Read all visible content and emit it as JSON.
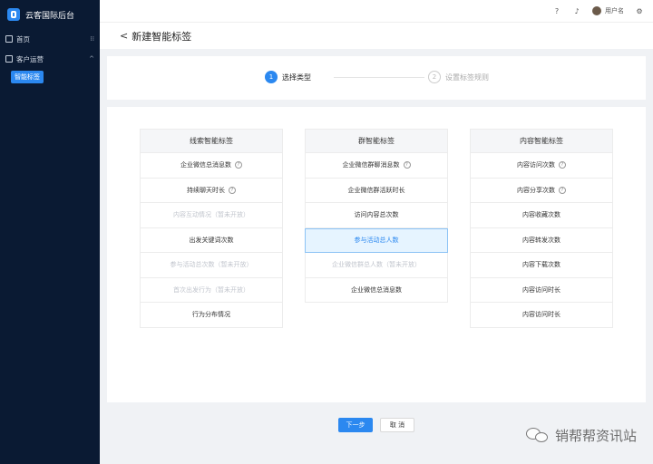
{
  "sidebar": {
    "brand": "云客国际后台",
    "items": [
      {
        "label": "首页",
        "trail": "⁞⁞"
      },
      {
        "label": "客户运营",
        "trail": "^"
      }
    ],
    "active_sub": "智能标签"
  },
  "topbar": {
    "username": "用户名"
  },
  "header": {
    "back": "<",
    "title": "新建智能标签"
  },
  "steps": [
    {
      "num": "1",
      "label": "选择类型"
    },
    {
      "num": "2",
      "label": "设置标签规则"
    }
  ],
  "columns": [
    {
      "title": "线索智能标签",
      "rows": [
        {
          "label": "企业微信总消息数",
          "help": true,
          "state": "normal"
        },
        {
          "label": "持续聊天时长",
          "help": true,
          "state": "normal"
        },
        {
          "label": "内容互动情况（暂未开放）",
          "help": false,
          "state": "disabled"
        },
        {
          "label": "出发关键词次数",
          "help": false,
          "state": "normal"
        },
        {
          "label": "参与活动总次数（暂未开放）",
          "help": false,
          "state": "disabled"
        },
        {
          "label": "首次出发行为（暂未开放）",
          "help": false,
          "state": "disabled"
        },
        {
          "label": "行为分布情况",
          "help": false,
          "state": "normal"
        }
      ]
    },
    {
      "title": "群智能标签",
      "rows": [
        {
          "label": "企业微信群聊消息数",
          "help": true,
          "state": "normal"
        },
        {
          "label": "企业微信群活跃时长",
          "help": false,
          "state": "normal"
        },
        {
          "label": "访问内容总次数",
          "help": false,
          "state": "normal"
        },
        {
          "label": "参与活动总人数",
          "help": false,
          "state": "selected"
        },
        {
          "label": "企业微信群总人数（暂未开放）",
          "help": false,
          "state": "disabled"
        },
        {
          "label": "企业微信总消息数",
          "help": false,
          "state": "normal"
        }
      ]
    },
    {
      "title": "内容智能标签",
      "rows": [
        {
          "label": "内容访问次数",
          "help": true,
          "state": "normal"
        },
        {
          "label": "内容分享次数",
          "help": true,
          "state": "normal"
        },
        {
          "label": "内容收藏次数",
          "help": false,
          "state": "normal"
        },
        {
          "label": "内容转发次数",
          "help": false,
          "state": "normal"
        },
        {
          "label": "内容下载次数",
          "help": false,
          "state": "normal"
        },
        {
          "label": "内容访问时长",
          "help": false,
          "state": "normal"
        },
        {
          "label": "内容访问时长",
          "help": false,
          "state": "normal"
        }
      ]
    }
  ],
  "buttons": {
    "next": "下一步",
    "cancel": "取 消"
  },
  "watermark": "销帮帮资讯站",
  "colors": {
    "primary": "#2b88f0",
    "sidebar": "#0a1a33",
    "selected_bg": "#e6f4ff"
  }
}
